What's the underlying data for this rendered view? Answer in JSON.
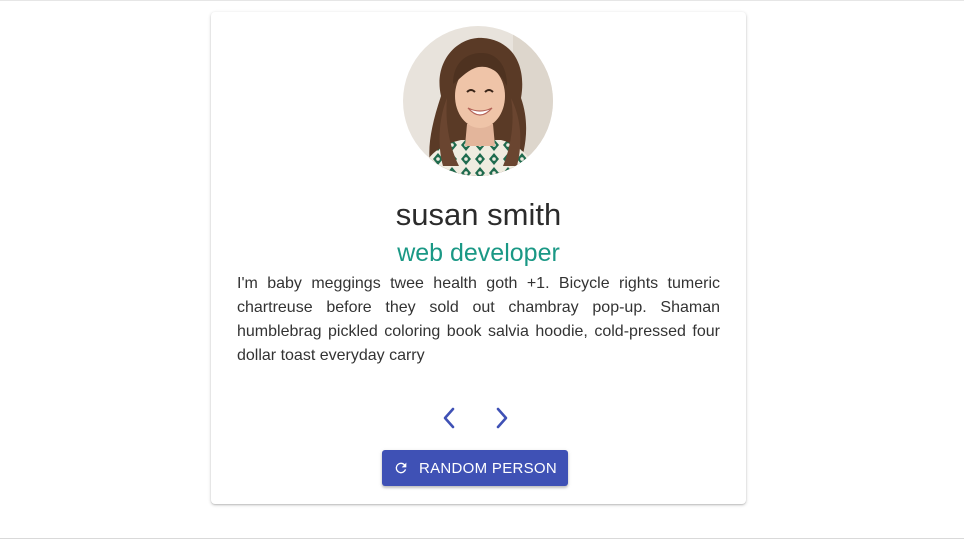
{
  "person": {
    "name": "susan smith",
    "job": "web developer",
    "text": "I'm baby meggings twee health goth +1. Bicycle rights tumeric chartreuse before they sold out chambray pop-up. Shaman humblebrag pickled coloring book salvia hoodie, cold-pressed four dollar toast everyday carry"
  },
  "controls": {
    "prev_icon": "chevron-left-icon",
    "next_icon": "chevron-right-icon",
    "random_icon": "refresh-icon",
    "random_label": "Random Person"
  },
  "colors": {
    "accent": "#3f51b5",
    "job_text": "#1a9885",
    "name_text": "#2b2b2b",
    "body_text": "#333333"
  }
}
